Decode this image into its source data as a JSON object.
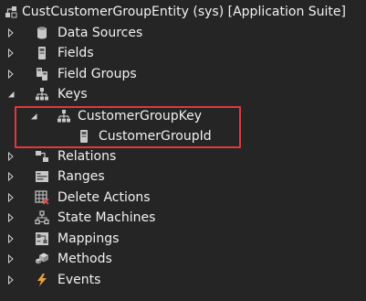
{
  "tree": {
    "root": {
      "label": "CustCustomerGroupEntity (sys) [Application Suite]",
      "icon": "data-entity-icon"
    },
    "items": [
      {
        "label": "Data Sources",
        "icon": "database-icon",
        "expanded": false
      },
      {
        "label": "Fields",
        "icon": "field-icon",
        "expanded": false
      },
      {
        "label": "Field Groups",
        "icon": "field-group-icon",
        "expanded": false
      },
      {
        "label": "Keys",
        "icon": "key-hierarchy-icon",
        "expanded": true,
        "children": [
          {
            "label": "CustomerGroupKey",
            "icon": "key-hierarchy-icon",
            "expanded": true,
            "children": [
              {
                "label": "CustomerGroupId",
                "icon": "field-icon"
              }
            ]
          }
        ]
      },
      {
        "label": "Relations",
        "icon": "relation-icon",
        "expanded": false
      },
      {
        "label": "Ranges",
        "icon": "range-icon",
        "expanded": false
      },
      {
        "label": "Delete Actions",
        "icon": "delete-action-icon",
        "expanded": false
      },
      {
        "label": "State Machines",
        "icon": "state-machine-icon",
        "expanded": false
      },
      {
        "label": "Mappings",
        "icon": "mapping-icon",
        "expanded": false
      },
      {
        "label": "Methods",
        "icon": "methods-icon",
        "expanded": false
      },
      {
        "label": "Events",
        "icon": "lightning-icon",
        "expanded": false
      }
    ]
  },
  "colors": {
    "background": "#252526",
    "text": "#f1f1f1",
    "highlight_border": "#e0383b",
    "events_icon": "#e8a33d"
  }
}
